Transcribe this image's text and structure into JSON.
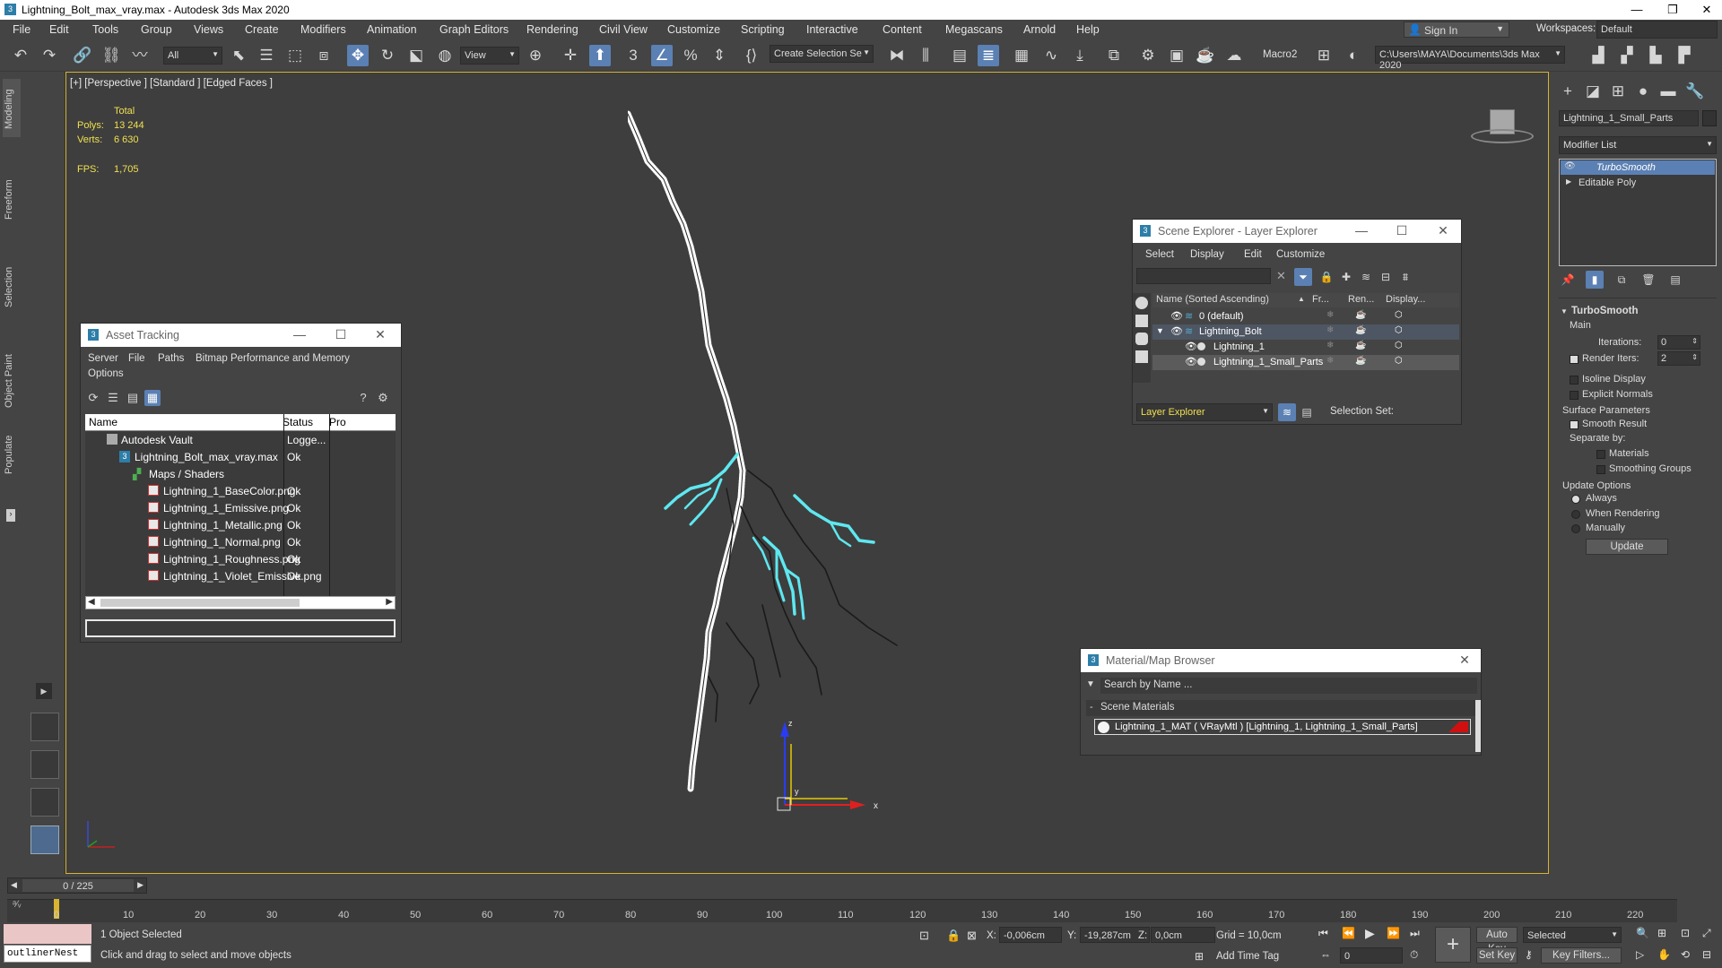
{
  "app": {
    "title": "Lightning_Bolt_max_vray.max - Autodesk 3ds Max 2020",
    "menu": [
      "File",
      "Edit",
      "Tools",
      "Group",
      "Views",
      "Create",
      "Modifiers",
      "Animation",
      "Graph Editors",
      "Rendering",
      "Civil View",
      "Customize",
      "Scripting",
      "Interactive",
      "Content",
      "Megascans",
      "Arnold",
      "Help"
    ],
    "sign_in": "Sign In",
    "workspaces_label": "Workspaces:",
    "workspace_value": "Default"
  },
  "toolbar": {
    "filter_value": "All",
    "view_value": "View",
    "selection_set": "Create Selection Se",
    "macro_label": "Macro2",
    "project_path": "C:\\Users\\MAYA\\Documents\\3ds Max 2020"
  },
  "left_tabs": [
    "Modeling",
    "Freeform",
    "Selection",
    "Object Paint",
    "Populate"
  ],
  "viewport": {
    "label": "[+] [Perspective ] [Standard ] [Edged Faces ]",
    "stats": {
      "total_label": "Total",
      "polys_label": "Polys:",
      "polys": "13 244",
      "verts_label": "Verts:",
      "verts": "6 630",
      "fps_label": "FPS:",
      "fps": "1,705"
    },
    "gizmo_label": "x",
    "gizmo_z": "z",
    "gizmo_y": "y"
  },
  "asset_tracking": {
    "title": "Asset Tracking",
    "menu": [
      "Server",
      "File",
      "Paths",
      "Bitmap Performance and Memory"
    ],
    "menu2": "Options",
    "columns": [
      "Name",
      "Status",
      "Pro"
    ],
    "rows": [
      {
        "name": "Autodesk Vault",
        "status": "Logge..."
      },
      {
        "name": "Lightning_Bolt_max_vray.max",
        "status": "Ok"
      },
      {
        "name": "Maps / Shaders",
        "status": ""
      },
      {
        "name": "Lightning_1_BaseColor.png",
        "status": "Ok"
      },
      {
        "name": "Lightning_1_Emissive.png",
        "status": "Ok"
      },
      {
        "name": "Lightning_1_Metallic.png",
        "status": "Ok"
      },
      {
        "name": "Lightning_1_Normal.png",
        "status": "Ok"
      },
      {
        "name": "Lightning_1_Roughness.png",
        "status": "Ok"
      },
      {
        "name": "Lightning_1_Violet_Emissive.png",
        "status": "Ok"
      }
    ]
  },
  "scene_explorer": {
    "title": "Scene Explorer - Layer Explorer",
    "menu": [
      "Select",
      "Display",
      "Edit",
      "Customize"
    ],
    "columns": [
      "Name (Sorted Ascending)",
      "Fr...",
      "Ren...",
      "Display..."
    ],
    "rows": [
      {
        "name": "0 (default)"
      },
      {
        "name": "Lightning_Bolt"
      },
      {
        "name": "Lightning_1"
      },
      {
        "name": "Lightning_1_Small_Parts"
      }
    ],
    "footer_dropdown": "Layer Explorer",
    "selection_set_label": "Selection Set:"
  },
  "material_browser": {
    "title": "Material/Map Browser",
    "search_placeholder": "Search by Name ...",
    "group": "Scene Materials",
    "material": "Lightning_1_MAT  ( VRayMtl )  [Lightning_1, Lightning_1_Small_Parts]"
  },
  "command_panel": {
    "object_name": "Lightning_1_Small_Parts",
    "modifier_list": "Modifier List",
    "stack": [
      "TurboSmooth",
      "Editable Poly"
    ],
    "rollout_title": "TurboSmooth",
    "main_label": "Main",
    "iterations_label": "Iterations:",
    "iterations": "0",
    "render_iters_label": "Render Iters:",
    "render_iters": "2",
    "isoline": "Isoline Display",
    "explicit_normals": "Explicit Normals",
    "surface_params": "Surface Parameters",
    "smooth_result": "Smooth Result",
    "separate_by": "Separate by:",
    "materials": "Materials",
    "smoothing_groups": "Smoothing Groups",
    "update_options": "Update Options",
    "always": "Always",
    "when_rendering": "When Rendering",
    "manually": "Manually",
    "update_btn": "Update"
  },
  "timeline": {
    "frame": "0 / 225",
    "ticks": [
      "0",
      "10",
      "20",
      "30",
      "40",
      "50",
      "60",
      "70",
      "80",
      "90",
      "100",
      "110",
      "120",
      "130",
      "140",
      "150",
      "160",
      "170",
      "180",
      "190",
      "200",
      "210",
      "220"
    ]
  },
  "status": {
    "maxscript": "outlinerNest",
    "selected": "1 Object Selected",
    "hint": "Click and drag to select and move objects",
    "x_label": "X:",
    "x": "-0,006cm",
    "y_label": "Y:",
    "y": "-19,287cm",
    "z_label": "Z:",
    "z": "0,0cm",
    "grid": "Grid = 10,0cm",
    "add_time_tag": "Add Time Tag",
    "auto_key": "Auto Key",
    "set_key": "Set Key",
    "selected_dropdown": "Selected",
    "key_filters": "Key Filters...",
    "frame_value": "0"
  },
  "colors": {
    "accent": "#5b80b3",
    "viewport_border": "#d8b430",
    "lightning_glow": "#5ee8f0"
  }
}
